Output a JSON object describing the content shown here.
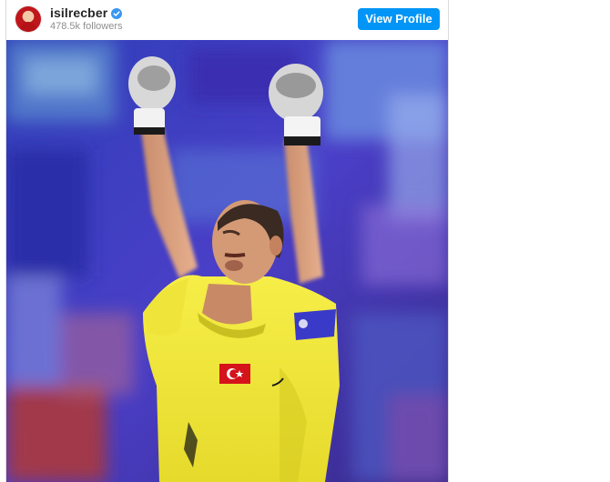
{
  "post": {
    "username": "isilrecber",
    "followers": "478.5k followers",
    "view_profile_label": "View Profile"
  },
  "icons": {
    "verified": "verified-badge-icon",
    "avatar": "profile-avatar"
  },
  "colors": {
    "button": "#0095f6",
    "verified": "#3897f0",
    "jersey": "#f2e93a",
    "background_blue": "#3a3fd0"
  }
}
